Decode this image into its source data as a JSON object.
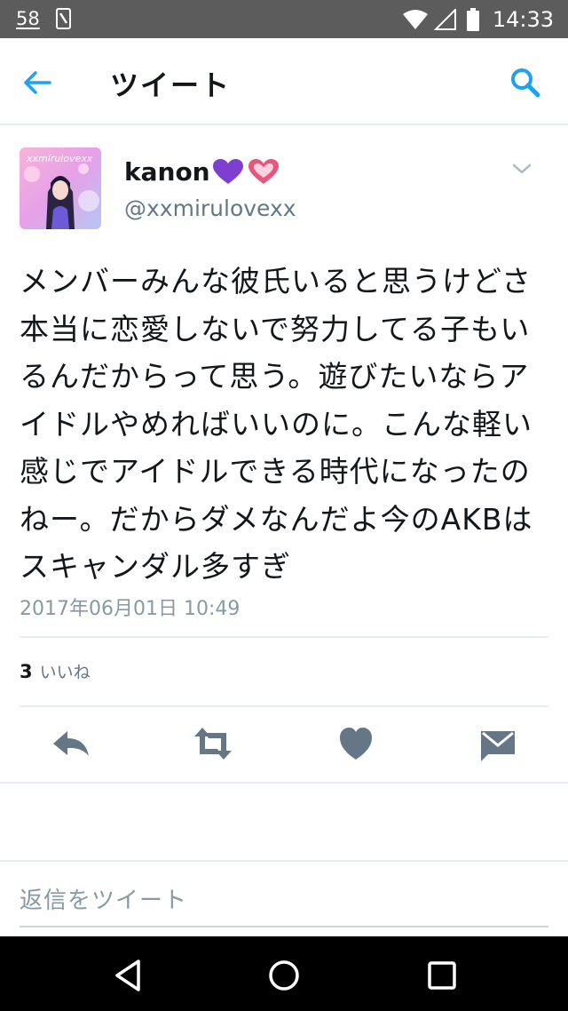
{
  "status_bar": {
    "notification_count": "58",
    "time": "14:33",
    "icons": [
      "sim-icon",
      "wifi-icon",
      "signal-icon",
      "battery-icon"
    ]
  },
  "header": {
    "title": "ツイート",
    "back_icon": "arrow-left-icon",
    "search_icon": "search-icon"
  },
  "tweet": {
    "display_name": "kanon",
    "name_emojis": [
      "purple-heart-icon",
      "pink-heart-icon"
    ],
    "username": "@xxmirulovexx",
    "avatar_text": "xxmirulovexx",
    "text": "メンバーみんな彼氏いると思うけどさ本当に恋愛しないで努力してる子もいるんだからって思う。遊びたいならアイドルやめればいいのに。こんな軽い感じでアイドルできる時代になったのねー。だからダメなんだよ今のAKBはスキャンダル多すぎ",
    "timestamp": "2017年06月01日 10:49",
    "likes_count": "3",
    "likes_label": "いいね"
  },
  "actions": [
    "reply-icon",
    "retweet-icon",
    "like-icon",
    "message-icon"
  ],
  "reply": {
    "placeholder": "返信をツイート"
  },
  "colors": {
    "accent": "#1da1f2",
    "action_gray": "#657786",
    "status_bar": "#5c5c5c",
    "purple_heart": "#7e3fd1",
    "pink_heart": "#e8557f"
  },
  "nav": [
    "back-triangle-icon",
    "home-circle-icon",
    "recents-square-icon"
  ]
}
